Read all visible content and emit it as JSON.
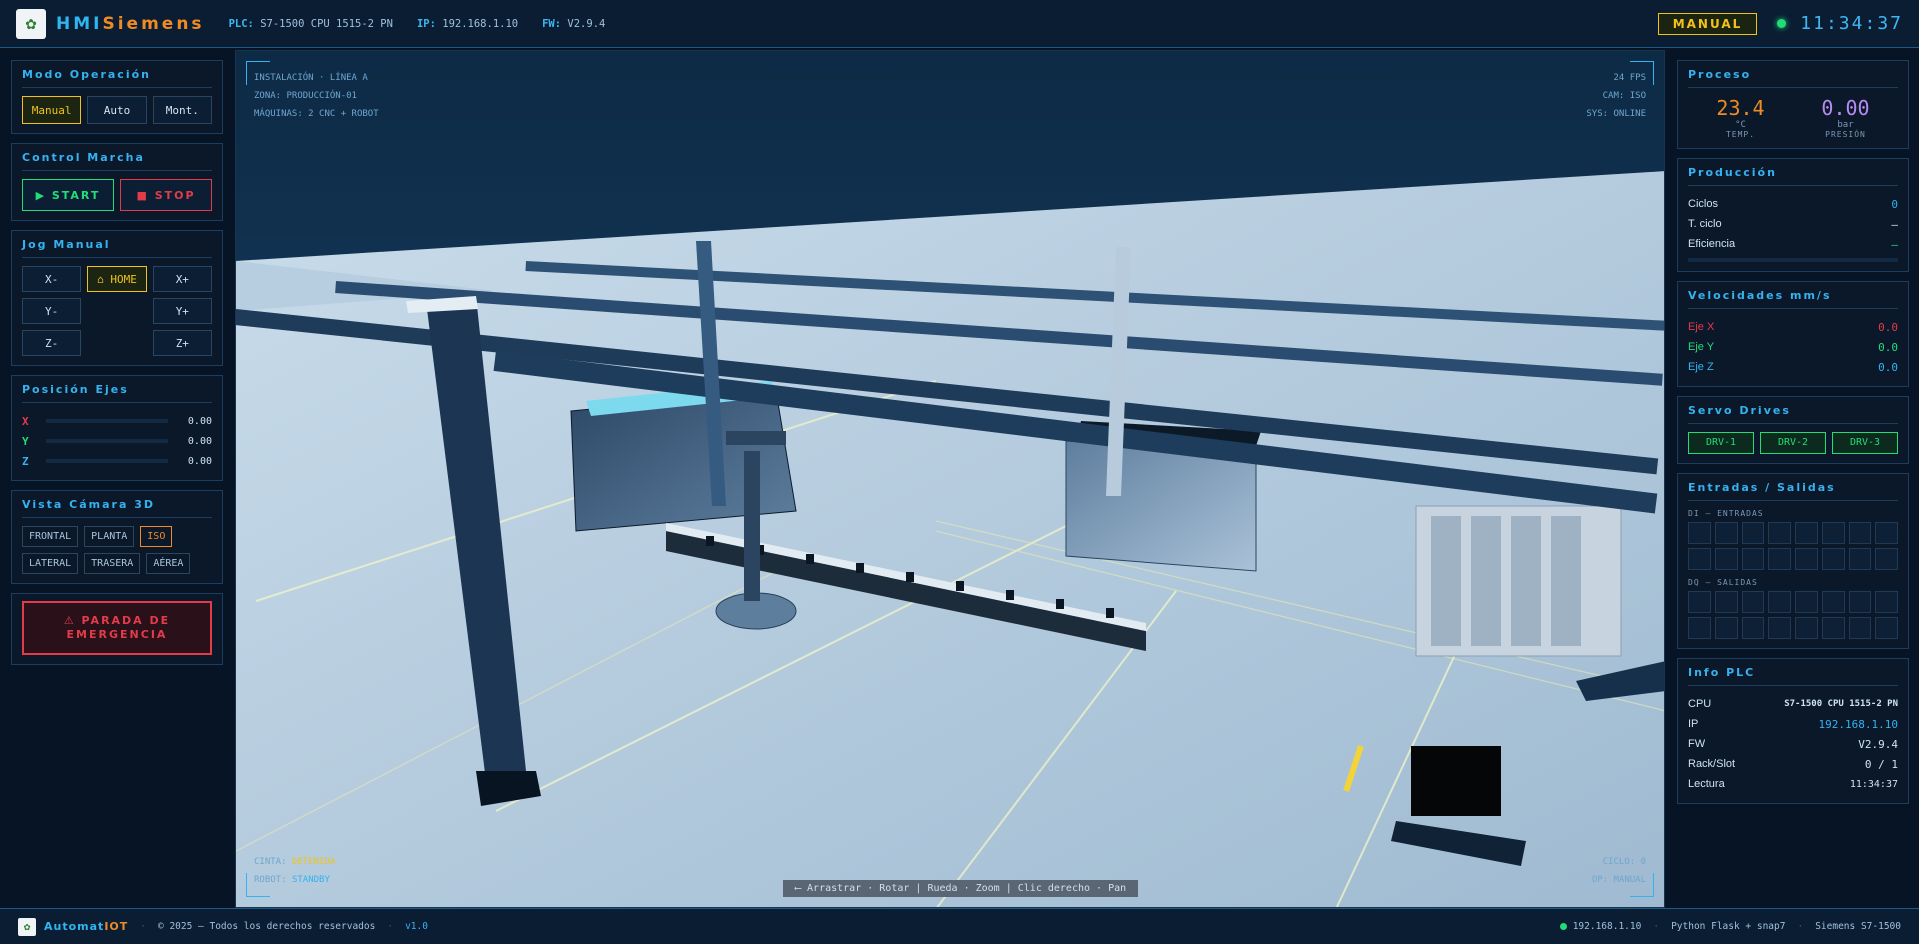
{
  "header": {
    "brand_a": "HMI",
    "brand_b": "Siemens",
    "plc_label": "PLC:",
    "plc_value": "S7-1500 CPU 1515-2 PN",
    "ip_label": "IP:",
    "ip_value": "192.168.1.10",
    "fw_label": "FW:",
    "fw_value": "V2.9.4",
    "mode_badge": "MANUAL",
    "clock": "11:34:37"
  },
  "left": {
    "mode": {
      "title": "Modo Operación",
      "buttons": [
        "Manual",
        "Auto",
        "Mont."
      ],
      "selected": 0
    },
    "control": {
      "title": "Control Marcha",
      "start": "▶ START",
      "stop": "■ STOP"
    },
    "jog": {
      "title": "Jog Manual",
      "xm": "X-",
      "home": "⌂ HOME",
      "xp": "X+",
      "ym": "Y-",
      "yp": "Y+",
      "zm": "Z-",
      "zp": "Z+"
    },
    "axes": {
      "title": "Posición Ejes",
      "items": [
        {
          "l": "X",
          "v": "0.00",
          "c": "#e23b4a"
        },
        {
          "l": "Y",
          "v": "0.00",
          "c": "#22dd77"
        },
        {
          "l": "Z",
          "v": "0.00",
          "c": "#35b2ef"
        }
      ]
    },
    "camera": {
      "title": "Vista Cámara 3D",
      "views": [
        "FRONTAL",
        "PLANTA",
        "ISO",
        "LATERAL",
        "TRASERA",
        "AÉREA"
      ],
      "selected": "ISO"
    },
    "estop": {
      "line1": "⚠ PARADA DE",
      "line2": "EMERGENCIA"
    }
  },
  "viewport": {
    "tl": [
      "INSTALACIÓN · LÍNEA A",
      "ZONA: PRODUCCIÓN-01",
      "MÁQUINAS: 2 CNC + ROBOT"
    ],
    "tr": [
      "24 FPS",
      "CAM: ISO",
      "SYS: ONLINE"
    ],
    "bl_cinta_label": "CINTA:",
    "bl_cinta_value": "DETENIDA",
    "bl_robot_label": "ROBOT:",
    "bl_robot_value": "STANDBY",
    "br": [
      "CICLO: 0",
      "OP: MANUAL"
    ],
    "hint": "⟵ Arrastrar · Rotar  |  Rueda · Zoom  |  Clic derecho · Pan"
  },
  "right": {
    "process": {
      "title": "Proceso",
      "temp": "23.4",
      "temp_unit": "°C",
      "temp_label": "TEMP.",
      "pres": "0.00",
      "pres_unit": "bar",
      "pres_label": "PRESIÓN"
    },
    "production": {
      "title": "Producción",
      "rows": [
        {
          "k": "Ciclos",
          "v": "0"
        },
        {
          "k": "T. ciclo",
          "v": "—"
        },
        {
          "k": "Eficiencia",
          "v": "—"
        }
      ]
    },
    "speeds": {
      "title": "Velocidades mm/s",
      "rows": [
        {
          "k": "Eje X",
          "v": "0.0",
          "c": "#e23b4a"
        },
        {
          "k": "Eje Y",
          "v": "0.0",
          "c": "#22dd77"
        },
        {
          "k": "Eje Z",
          "v": "0.0",
          "c": "#35b2ef"
        }
      ]
    },
    "servo": {
      "title": "Servo Drives",
      "drives": [
        "DRV-1",
        "DRV-2",
        "DRV-3"
      ]
    },
    "io": {
      "title": "Entradas / Salidas",
      "di": "DI — ENTRADAS",
      "dq": "DQ — SALIDAS"
    },
    "plc": {
      "title": "Info PLC",
      "rows": [
        {
          "k": "CPU",
          "v": "S7-1500 CPU 1515-2 PN"
        },
        {
          "k": "IP",
          "v": "192.168.1.10"
        },
        {
          "k": "FW",
          "v": "V2.9.4"
        },
        {
          "k": "Rack/Slot",
          "v": "0 / 1"
        },
        {
          "k": "Lectura",
          "v": "11:34:37"
        }
      ]
    }
  },
  "footer": {
    "brand_a": "Automat",
    "brand_b": "IOT",
    "copyright": "© 2025 — Todos los derechos reservados",
    "version": "v1.0",
    "ip": "192.168.1.10",
    "stack": "Python Flask + snap7",
    "device": "Siemens S7-1500"
  }
}
